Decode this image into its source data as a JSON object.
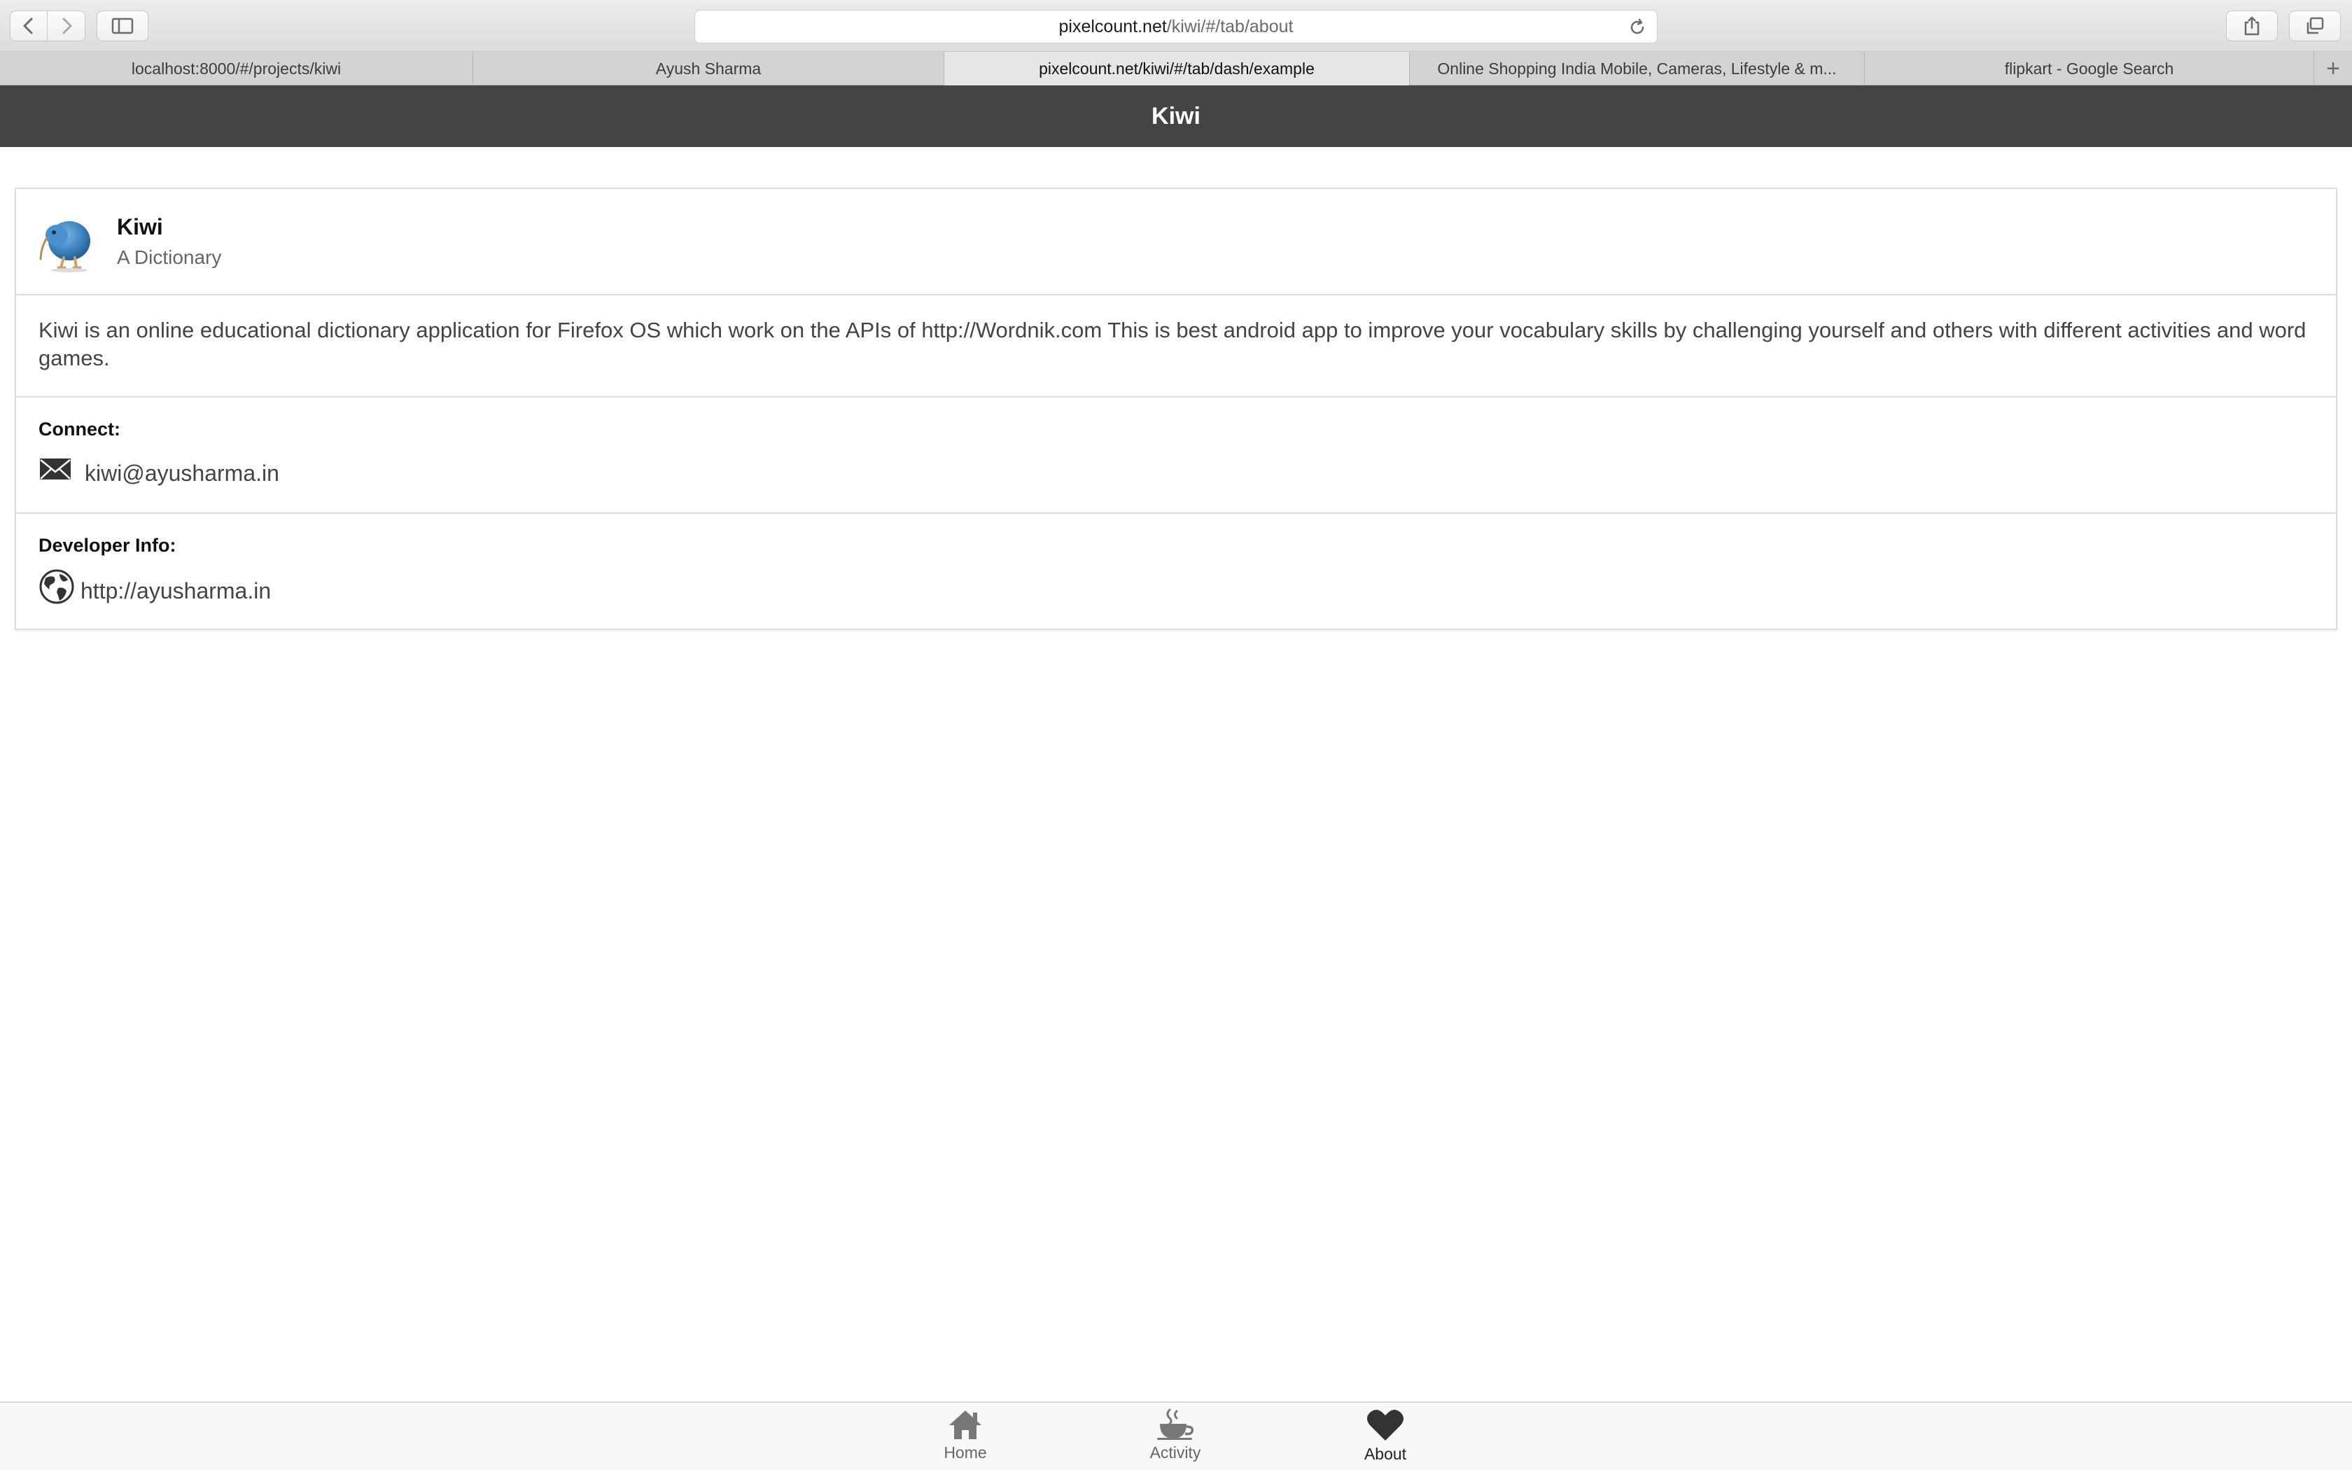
{
  "browser": {
    "url_host": "pixelcount.net",
    "url_path": "/kiwi/#/tab/about",
    "tabs": [
      {
        "label": "localhost:8000/#/projects/kiwi",
        "active": false
      },
      {
        "label": "Ayush Sharma",
        "active": false
      },
      {
        "label": "pixelcount.net/kiwi/#/tab/dash/example",
        "active": true
      },
      {
        "label": "Online Shopping India Mobile, Cameras, Lifestyle & m...",
        "active": false
      },
      {
        "label": "flipkart - Google Search",
        "active": false
      }
    ],
    "new_tab_label": "+"
  },
  "header": {
    "title": "Kiwi"
  },
  "app": {
    "name": "Kiwi",
    "subtitle": "A Dictionary",
    "avatar_icon": "kiwi-bird-icon",
    "description": "Kiwi is an online educational dictionary application for Firefox OS which work on the APIs of http://Wordnik.com This is best android app to improve your vocabulary skills by challenging yourself and others with different activities and word games."
  },
  "connect": {
    "label": "Connect:",
    "icon": "envelope-icon",
    "email": "kiwi@ayusharma.in"
  },
  "developer": {
    "label": "Developer Info:",
    "icon": "globe-icon",
    "website": "http://ayusharma.in"
  },
  "bottom_tabs": [
    {
      "label": "Home",
      "icon": "home-icon",
      "active": false
    },
    {
      "label": "Activity",
      "icon": "coffee-icon",
      "active": false
    },
    {
      "label": "About",
      "icon": "heart-icon",
      "active": true
    }
  ],
  "colors": {
    "header_bg": "#444444",
    "active_tab_icon": "#333333",
    "inactive_tab_icon": "#777777"
  }
}
